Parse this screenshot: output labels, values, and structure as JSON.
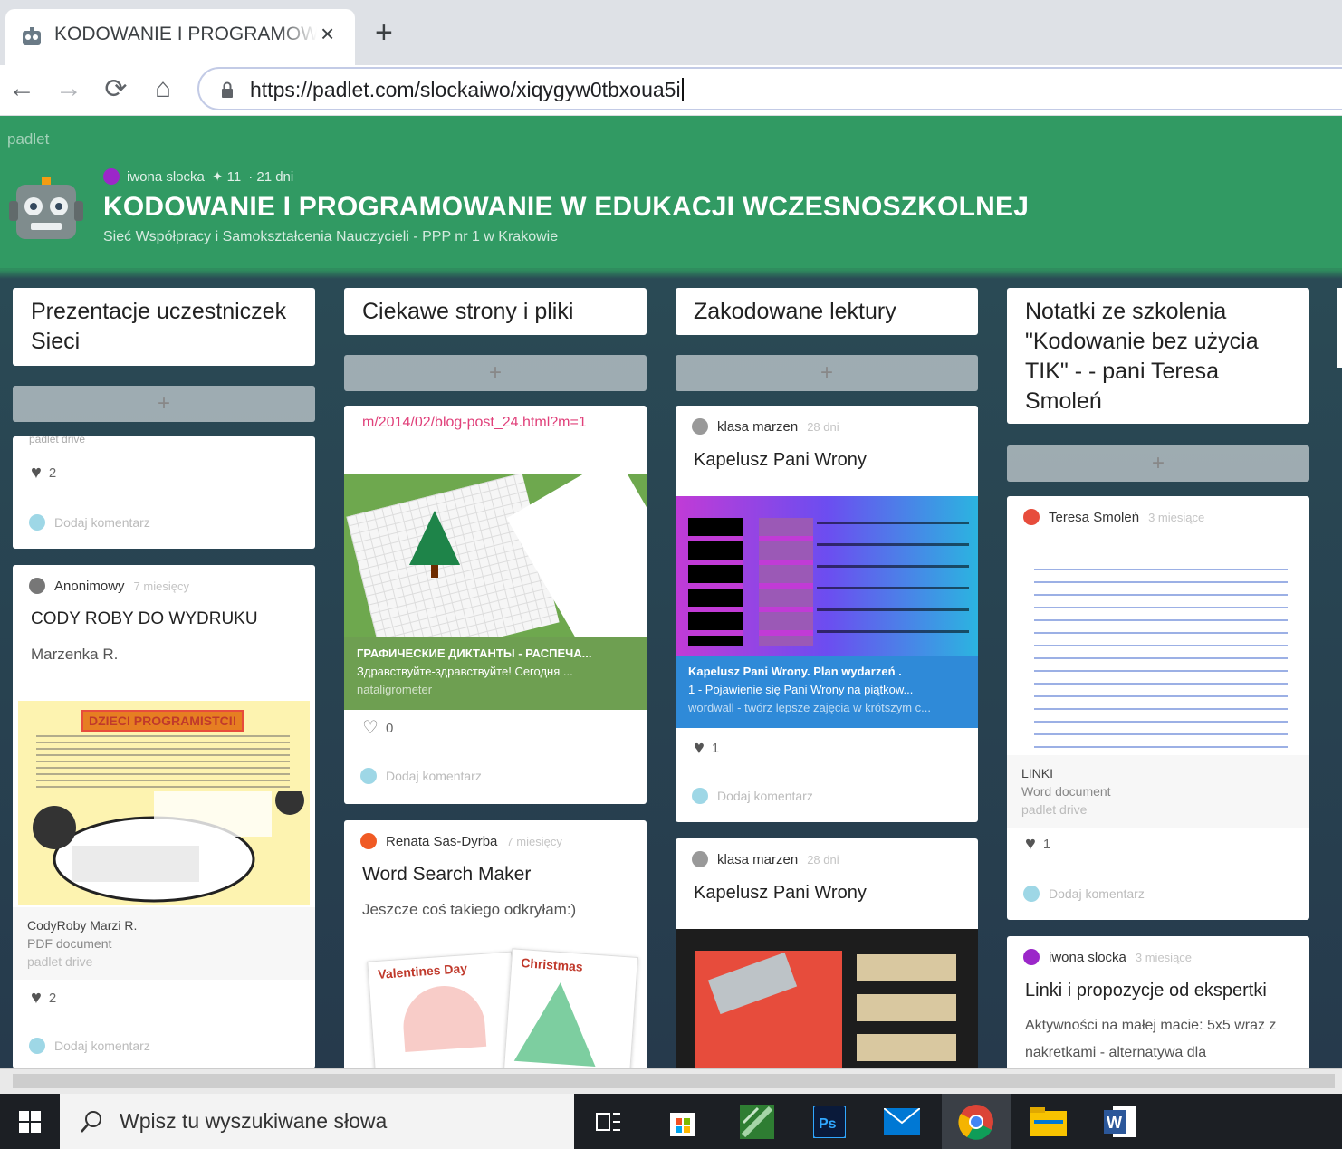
{
  "browser": {
    "tab_title": "KODOWANIE I PROGRAMOWANIE",
    "tab_close": "×",
    "new_tab": "+",
    "url": "https://padlet.com/slockaiwo/xiqygyw0tbxoua5i",
    "back_icon": "←",
    "forward_icon": "→",
    "reload_icon": "⟳",
    "home_icon": "⌂"
  },
  "padlet": {
    "brand": "padlet",
    "author": "iwona slocka",
    "likes": "✦ 11",
    "age": "· 21 dni",
    "title": "KODOWANIE I PROGRAMOWANIE W EDUKACJI WCZESNOSZKOLNEJ",
    "subtitle": "Sieć Współpracy i Samokształcenia Nauczycieli - PPP nr 1 w Krakowie",
    "add_label": "+"
  },
  "columns": [
    {
      "header": "Prezentacje uczestniczek Sieci",
      "cards": [
        {
          "attach_line": "padlet drive",
          "likes": "2",
          "comment": "Dodaj komentarz"
        },
        {
          "author": "Anonimowy",
          "age": "7 miesięcy",
          "title": "CODY ROBY DO WYDRUKU",
          "body": "Marzenka R.",
          "image_banner": "DZIECI PROGRAMISTCI!",
          "file_name": "CodyRoby Marzi R.",
          "file_type": "PDF document",
          "file_source": "padlet drive",
          "likes": "2",
          "comment": "Dodaj komentarz"
        }
      ]
    },
    {
      "header": "Ciekawe strony i pliki",
      "cards": [
        {
          "link": "m/2014/02/blog-post_24.html?m=1",
          "link_title": "ГРАФИЧЕСКИЕ ДИКТАНТЫ - РАСПЕЧА...",
          "link_desc": "Здравствуйте-здравствуйте! Сегодня ...",
          "link_source": "nataligrometer",
          "likes": "0",
          "comment": "Dodaj komentarz"
        },
        {
          "author": "Renata Sas-Dyrba",
          "age": "7 miesięcy",
          "title": "Word Search Maker",
          "body": "Jeszcze coś takiego odkryłam:)",
          "image_left": "Valentines Day",
          "image_right": "Christmas"
        }
      ]
    },
    {
      "header": "Zakodowane lektury",
      "cards": [
        {
          "author": "klasa marzen",
          "age": "28 dni",
          "title": "Kapelusz Pani Wrony",
          "link_title": "Kapelusz Pani Wrony. Plan wydarzeń .",
          "link_desc": "1 - Pojawienie się Pani Wrony na piątkow...",
          "link_source": "wordwall - twórz lepsze zajęcia w krótszym c...",
          "likes": "1",
          "comment": "Dodaj komentarz"
        },
        {
          "author": "klasa marzen",
          "age": "28 dni",
          "title": "Kapelusz Pani Wrony"
        }
      ]
    },
    {
      "header": "Notatki ze szkolenia \"Kodowanie bez użycia TIK\" - - pani Teresa Smoleń",
      "cards": [
        {
          "author": "Teresa Smoleń",
          "age": "3 miesiące",
          "file_name": "LINKI",
          "file_type": "Word document",
          "file_source": "padlet drive",
          "likes": "1",
          "comment": "Dodaj komentarz"
        },
        {
          "author": "iwona slocka",
          "age": "3 miesiące",
          "title": "Linki i propozycje od ekspertki",
          "body": "Aktywności na małej macie: 5x5 wraz z nakretkami - alternatywa dla"
        }
      ]
    }
  ],
  "taskbar": {
    "search_placeholder": "Wpisz tu wyszukiwane słowa",
    "apps": [
      "task-view",
      "store",
      "maps",
      "photoshop",
      "mail",
      "chrome",
      "file-explorer",
      "word"
    ]
  },
  "colors": {
    "padlet_green": "#319a63",
    "board_dark": "#263a4c",
    "link_pink": "#e0407a",
    "wordwall_blue": "#2f8ad8"
  }
}
